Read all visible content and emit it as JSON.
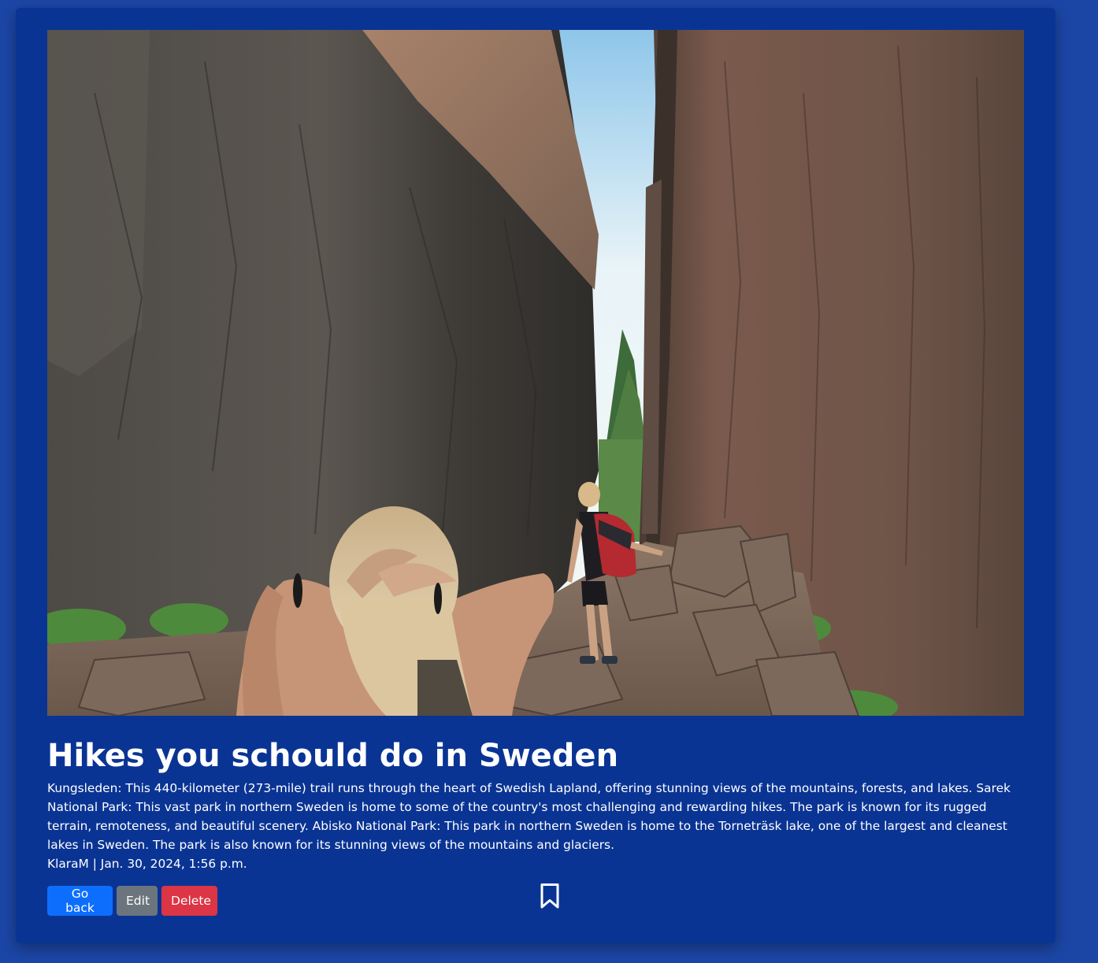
{
  "post": {
    "image_alt": "Two hikers walking through a narrow rock canyon between tall cliff walls",
    "title": "Hikes you schould do in Sweden",
    "body": "Kungsleden: This 440-kilometer (273-mile) trail runs through the heart of Swedish Lapland, offering stunning views of the mountains, forests, and lakes. Sarek National Park: This vast park in northern Sweden is home to some of the country's most challenging and rewarding hikes. The park is known for its rugged terrain, remoteness, and beautiful scenery. Abisko National Park: This park in northern Sweden is home to the Torneträsk lake, one of the largest and cleanest lakes in Sweden. The park is also known for its stunning views of the mountains and glaciers.",
    "meta": "KlaraM | Jan. 30, 2024, 1:56 p.m."
  },
  "actions": {
    "back_label": "Go back",
    "edit_label": "Edit",
    "delete_label": "Delete",
    "bookmark_icon": "bookmark-icon"
  },
  "colors": {
    "page_bg": "#1c46a6",
    "card_bg": "#0a3494",
    "primary": "#0d6efd",
    "secondary": "#6c757d",
    "danger": "#dc3545"
  }
}
